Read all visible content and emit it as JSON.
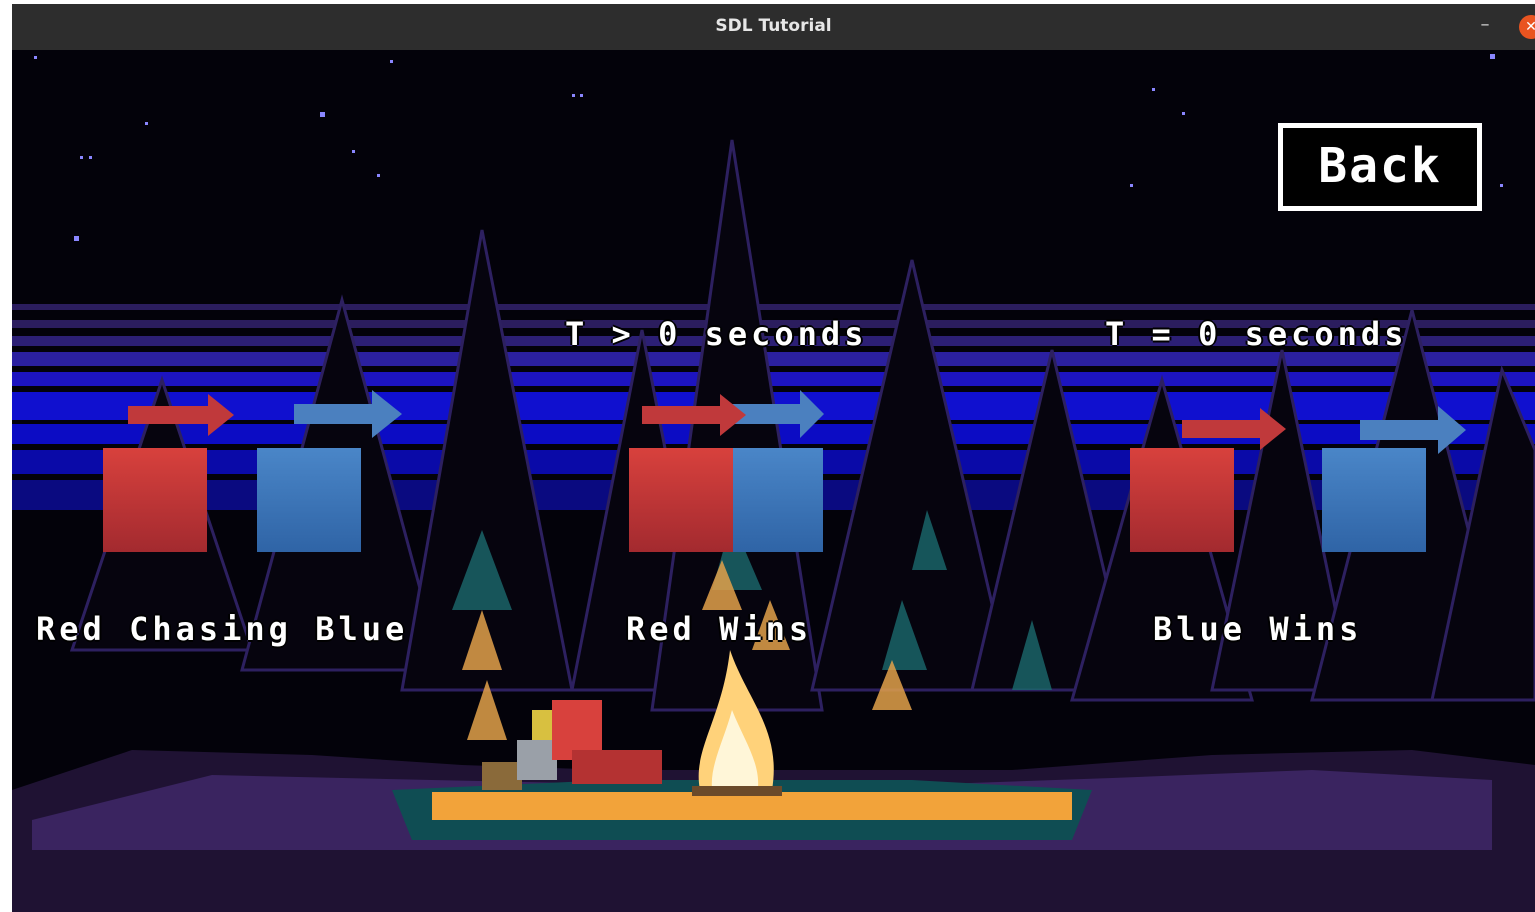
{
  "window": {
    "title": "SDL Tutorial",
    "minimize_glyph": "–",
    "close_glyph": "✕"
  },
  "menu": {
    "back_label": "Back"
  },
  "panels": [
    {
      "time_label": "",
      "caption": "Red Chasing Blue"
    },
    {
      "time_label": "T > 0 seconds",
      "caption": "Red Wins"
    },
    {
      "time_label": "T = 0 seconds",
      "caption": "Blue Wins"
    }
  ],
  "colors": {
    "red_box": "#c23538",
    "blue_box": "#3a73b8",
    "red_arrow": "#c0393b",
    "blue_arrow": "#4b80bf",
    "sky_band": "#1010c8",
    "fire": "#ffd27a",
    "ground": "#f2a33a"
  }
}
